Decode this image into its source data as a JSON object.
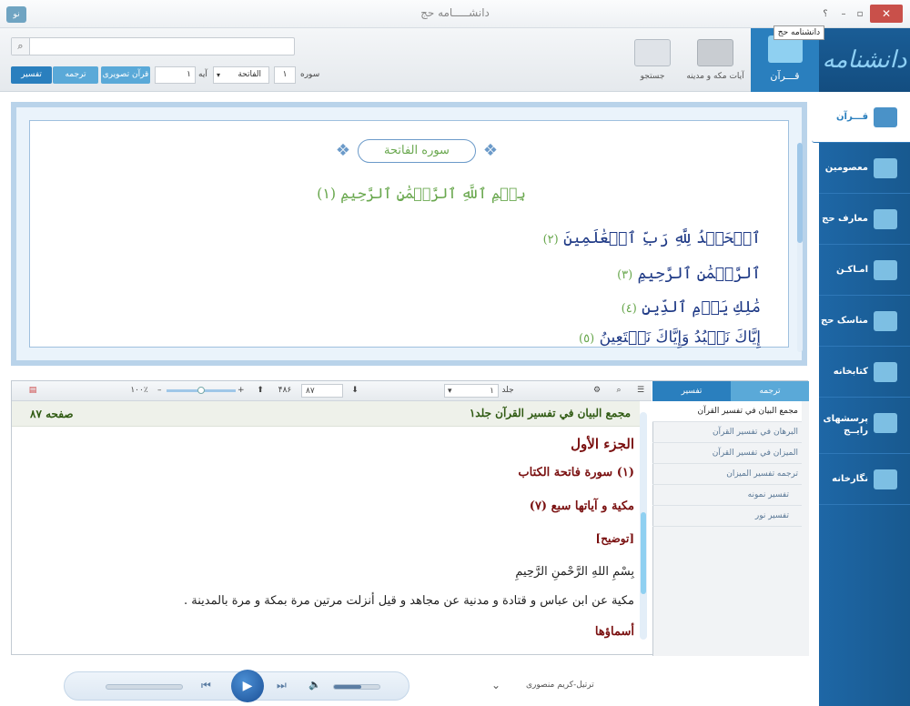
{
  "window": {
    "title": "دانشـــــامه حج",
    "tooltip": "دانشنامه حج",
    "help": "؟",
    "minimize": "–",
    "restore": "▫",
    "close": "✕",
    "logo": "نو"
  },
  "toolbar": {
    "search_placeholder": "",
    "tafsir_button": "تفسیر",
    "tarjome_button": "ترجمه",
    "quran_tasviri_button": "قرآن تصویری",
    "ayeh_label": "آیه",
    "ayeh_value": "۱",
    "surah_label": "سوره",
    "surah_number": "۱",
    "surah_select": "الفاتحة",
    "tools": [
      {
        "label": "جستجو"
      },
      {
        "label": "آیات مکه و مدینه"
      }
    ],
    "quran_tab": "قـــرآن",
    "brand": "دانشنامه حج"
  },
  "sidebar": {
    "items": [
      {
        "label": "قـــرآن",
        "icon": "quran-icon"
      },
      {
        "label": "معصومین",
        "icon": "masumin-icon"
      },
      {
        "label": "معارف حج",
        "icon": "kaaba-icon"
      },
      {
        "label": "امـاکـن",
        "icon": "places-icon"
      },
      {
        "label": "مناسک حج",
        "icon": "pilgrim-icon"
      },
      {
        "label": "کتابخانه",
        "icon": "library-icon"
      },
      {
        "label": "پرسشهای رایــج",
        "icon": "faq-icon"
      },
      {
        "label": "نگارخانه",
        "icon": "gallery-icon"
      }
    ]
  },
  "quran": {
    "surah_title": "سوره الفاتحة",
    "bismillah": "بِسۡمِ ٱللَّهِ ٱلرَّحۡمَٰنِ ٱلرَّحِيمِ (١)",
    "verses": [
      {
        "text": "ٱلۡحَمۡدُ لِلَّهِ رَبِّ ٱلۡعَٰلَمِينَ",
        "num": "(٢)"
      },
      {
        "text": "ٱلرَّحۡمَٰنِ ٱلرَّحِيمِ",
        "num": "(٣)"
      },
      {
        "text": "مَٰلِكِ يَوۡمِ ٱلدِّينِ",
        "num": "(٤)"
      },
      {
        "text": "إِيَّاكَ نَعۡبُدُ وَإِيَّاكَ نَسۡتَعِينُ",
        "num": "(٥)"
      }
    ]
  },
  "lower": {
    "zoom": "١٠٠٪",
    "page_current": "٨٧",
    "page_total": "۴٨۶",
    "volume_label": "جلد",
    "volume_value": "١",
    "book_title": "مجمع البيان في تفسير القرآن جلد١",
    "page_label": "صفحه ٨٧",
    "lines": [
      {
        "text": "الجزء الأول",
        "color": "#7a1010",
        "size": "15px",
        "weight": "bold"
      },
      {
        "text": "(١) سورة فاتحة الكتاب",
        "color": "#7a1010",
        "size": "13px",
        "weight": "bold"
      },
      {
        "text": "مكية و آياتها سبع (٧)",
        "color": "#7a1010",
        "size": "13px",
        "weight": "bold"
      },
      {
        "text": "[توضيح]",
        "color": "#7a1010",
        "size": "12px",
        "weight": "bold"
      },
      {
        "text": "بِسْمِ اللهِ الرَّحْمنِ الرَّحِيمِ",
        "color": "#222",
        "size": "13px",
        "weight": "normal"
      },
      {
        "text": "مكية عن ابن عباس و قتادة و مدنية عن مجاهد و قيل أنزلت مرتين مرة بمكة و مرة بالمدينة .",
        "color": "#222",
        "size": "13px",
        "weight": "normal"
      },
      {
        "text": "أسماؤها",
        "color": "#7a1010",
        "size": "13px",
        "weight": "bold"
      }
    ],
    "tabs": {
      "tarjome": "ترجمه",
      "tafsir": "تفسیر"
    },
    "tafsir_list": [
      "مجمع البيان في تفسير القرآن",
      "البرهان في تفسير القرآن",
      "الميزان في تفسير القرآن",
      "ترجمه تفسیر المیزان",
      "تفسیر نمونه",
      "تفسیر نور"
    ]
  },
  "player": {
    "reciter": "ترتیل-کریم منصوری",
    "progress": 0.0,
    "volume": 0.6
  }
}
